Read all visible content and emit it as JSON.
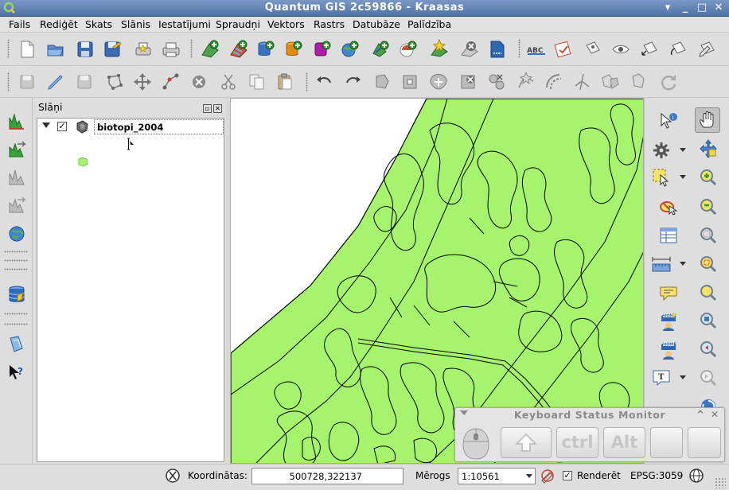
{
  "window": {
    "title": "Quantum GIS 2c59866 - Kraasas"
  },
  "menu": [
    "Fails",
    "Rediģēt",
    "Skats",
    "Slānis",
    "Iestatījumi",
    "Spraudņi",
    "Vektors",
    "Rastrs",
    "Datubāze",
    "Palīdzība"
  ],
  "layers_panel": {
    "title": "Slāņi",
    "layer": {
      "name": "biotopi_2004",
      "checked": true,
      "fill_color": "#a6f46e"
    }
  },
  "statusbar": {
    "coord_label": "Koordinātas:",
    "coord_value": "500728,322137",
    "scale_label": "Mērogs",
    "scale_value": "1:10561",
    "render_label": "Renderēt",
    "render_checked": true,
    "crs": "EPSG:3059"
  },
  "keyboard_monitor": {
    "title": "Keyboard Status Monitor",
    "keys": [
      "ctrl",
      "Alt"
    ]
  },
  "colors": {
    "map_fill": "#a6f46e",
    "map_line": "#000000",
    "titlebar": "#5d7fb3"
  }
}
